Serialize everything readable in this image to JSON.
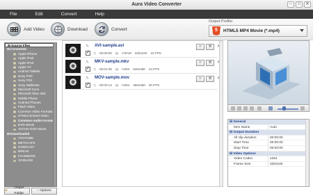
{
  "window": {
    "title": "Aura Video Converter",
    "minimize": "–",
    "maximize": "□",
    "close": "✕"
  },
  "menu": [
    "File",
    "Edit",
    "Convert",
    "Help"
  ],
  "toolbar": {
    "add_video": "Add Video",
    "download": "Download",
    "convert": "Convert",
    "output_profile_label": "Output Profile:",
    "output_profile_value": "HTML5 MP4 Movie (*.mp4)",
    "profile_badge": "5"
  },
  "sidebar": {
    "root": "Source Files",
    "converted_header": "Converted",
    "converted_items": [
      "Apple iPhone",
      "Apple iPad",
      "Apple iPod",
      "Apple TV",
      "Android Tablets",
      "Sony PSP",
      "Sony PS3",
      "Sony Walkman",
      "Microsoft Zune",
      "Microsoft Xbox 360",
      "Mobile Phone",
      "Android Phones",
      "Flash Video",
      "Common Video Formats",
      "HTML5 Embed Video",
      "Common Audio Formats",
      "DVD Movie",
      "AVCHD DVD Movie"
    ],
    "bold_item_index": 15,
    "downloaded_header": "Downloaded",
    "downloaded_items": [
      "YOUTUBE",
      "METACAFE",
      "HOWCAST",
      "BREAK",
      "FACEBOOK",
      "12VELEW"
    ],
    "output_folder": "Output Folder",
    "options": "Options"
  },
  "files": [
    {
      "name": "AVI-sample.avi",
      "duration": "00:00:00",
      "codec": "CRAM",
      "resolution": "320x240",
      "fps": "15 FPS"
    },
    {
      "name": "MKV-sample.mkv",
      "duration": "00:01:05",
      "codec": "H264",
      "resolution": "640x480",
      "fps": "24 FPS"
    },
    {
      "name": "MOV-sample.mov",
      "duration": "00:00:14",
      "codec": "H264",
      "resolution": "480x360",
      "fps": "30 FPS"
    }
  ],
  "properties": {
    "rows": [
      {
        "type": "header",
        "label": "General"
      },
      {
        "type": "row",
        "key": "Item Name",
        "value": "Auto"
      },
      {
        "type": "header",
        "label": "Output Duration"
      },
      {
        "type": "row",
        "key": "All clip duration",
        "value": "00:00:00"
      },
      {
        "type": "row",
        "key": "Start Time",
        "value": "00:00:00"
      },
      {
        "type": "row",
        "key": "Stop Time",
        "value": "00:00:00"
      },
      {
        "type": "header",
        "label": "Video Options"
      },
      {
        "type": "row",
        "key": "Video Codec",
        "value": "x264"
      },
      {
        "type": "row",
        "key": "Frame Size",
        "value": "320x240"
      }
    ]
  },
  "colors": {
    "menubar": "#3a3a3a",
    "sidebar": "#8d8d8d",
    "link": "#1f3f8a",
    "html5": "#e44d26"
  }
}
